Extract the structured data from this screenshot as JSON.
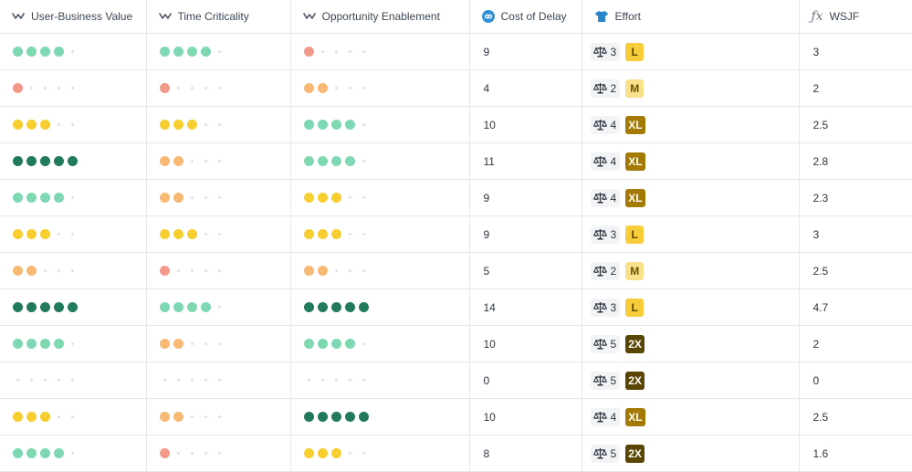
{
  "columns": {
    "ubv": {
      "label": "User-Business Value",
      "icon": "rating-icon"
    },
    "tc": {
      "label": "Time Criticality",
      "icon": "rating-icon"
    },
    "oe": {
      "label": "Opportunity Enablement",
      "icon": "rating-icon"
    },
    "cod": {
      "label": "Cost of Delay",
      "icon": "formula-link-icon"
    },
    "effort": {
      "label": "Effort",
      "icon": "shirt-icon"
    },
    "wsjf": {
      "label": "WSJF",
      "icon": "fx-icon"
    }
  },
  "colors": {
    "1": "#f3998a",
    "2": "#f7b973",
    "3": "#f7ce2f",
    "4": "#7ed9b2",
    "5": "#217a5a",
    "empty": "#dde1e6",
    "badge_L": {
      "bg": "#f7cd3b",
      "fg": "#5a4400"
    },
    "badge_M": {
      "bg": "#fbe08c",
      "fg": "#6b5400"
    },
    "badge_XL": {
      "bg": "#a47a05",
      "fg": "#ffffff"
    },
    "badge_2X": {
      "bg": "#5a4503",
      "fg": "#ffffff"
    }
  },
  "rows": [
    {
      "ubv": 4,
      "tc": 4,
      "oe": 1,
      "cod": "9",
      "effort": "3",
      "size": "L",
      "wsjf": "3"
    },
    {
      "ubv": 1,
      "tc": 1,
      "oe": 2,
      "cod": "4",
      "effort": "2",
      "size": "M",
      "wsjf": "2"
    },
    {
      "ubv": 3,
      "tc": 3,
      "oe": 4,
      "cod": "10",
      "effort": "4",
      "size": "XL",
      "wsjf": "2.5"
    },
    {
      "ubv": 5,
      "tc": 2,
      "oe": 4,
      "cod": "11",
      "effort": "4",
      "size": "XL",
      "wsjf": "2.8"
    },
    {
      "ubv": 4,
      "tc": 2,
      "oe": 3,
      "cod": "9",
      "effort": "4",
      "size": "XL",
      "wsjf": "2.3"
    },
    {
      "ubv": 3,
      "tc": 3,
      "oe": 3,
      "cod": "9",
      "effort": "3",
      "size": "L",
      "wsjf": "3"
    },
    {
      "ubv": 2,
      "tc": 1,
      "oe": 2,
      "cod": "5",
      "effort": "2",
      "size": "M",
      "wsjf": "2.5"
    },
    {
      "ubv": 5,
      "tc": 4,
      "oe": 5,
      "cod": "14",
      "effort": "3",
      "size": "L",
      "wsjf": "4.7"
    },
    {
      "ubv": 4,
      "tc": 2,
      "oe": 4,
      "cod": "10",
      "effort": "5",
      "size": "2X",
      "wsjf": "2"
    },
    {
      "ubv": 0,
      "tc": 0,
      "oe": 0,
      "cod": "0",
      "effort": "5",
      "size": "2X",
      "wsjf": "0"
    },
    {
      "ubv": 3,
      "tc": 2,
      "oe": 5,
      "cod": "10",
      "effort": "4",
      "size": "XL",
      "wsjf": "2.5"
    },
    {
      "ubv": 4,
      "tc": 1,
      "oe": 3,
      "cod": "8",
      "effort": "5",
      "size": "2X",
      "wsjf": "1.6"
    }
  ],
  "max_rating": 5,
  "effort_icon": "scale-icon"
}
